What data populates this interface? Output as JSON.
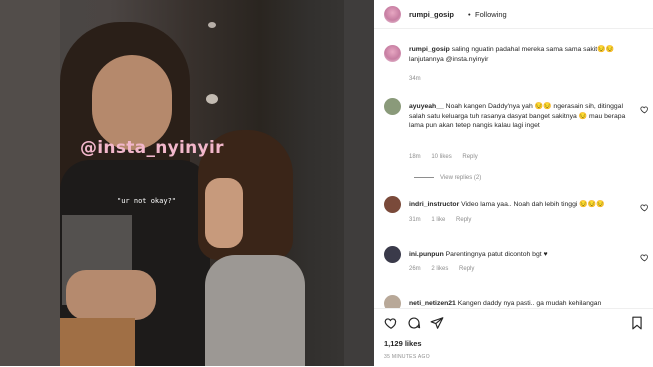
{
  "media": {
    "watermark": "@insta_nyinyir",
    "caption_overlay": "\"ur not okay?\""
  },
  "header": {
    "username": "rumpi_gosip",
    "separator": "•",
    "follow_label": "Following",
    "more_icon": "more-horizontal-icon"
  },
  "post_caption": {
    "username": "rumpi_gosip",
    "text": "saling nguatin padahal mereka sama sama sakit😔😔 lanjutannya @insta.nyinyir",
    "time": "34m"
  },
  "comments": [
    {
      "username": "ayuyeah__",
      "text": "Noah kangen Daddy'nya yah 😔😔 ngerasain sih, ditinggal salah satu keluarga tuh rasanya dasyat banget sakitnya 😔 mau berapa lama pun akan tetep nangis kalau lagi inget",
      "time": "18m",
      "likes": "10 likes",
      "reply": "Reply",
      "avatar_color": "#8a9a7a"
    },
    {
      "username": "indri_instructor",
      "text": "Video lama yaa.. Noah dah lebih tinggi 😔😔😔",
      "time": "31m",
      "likes": "1 like",
      "reply": "Reply",
      "avatar_color": "#7a4a3a"
    },
    {
      "username": "ini.punpun",
      "text": "Parentingnya patut dicontoh bgt ♥",
      "time": "26m",
      "likes": "2 likes",
      "reply": "Reply",
      "avatar_color": "#3a3a4a"
    },
    {
      "username": "neti_netizen21",
      "text": "Kangen daddy nya pasti.. ga mudah kehilangan",
      "avatar_color": "#b8a898"
    }
  ],
  "view_replies": "View replies (2)",
  "actions": {
    "icons": [
      "heart-icon",
      "comment-icon",
      "share-icon",
      "bookmark-icon"
    ],
    "likes": "1,129 likes",
    "time_ago": "35 MINUTES AGO"
  }
}
